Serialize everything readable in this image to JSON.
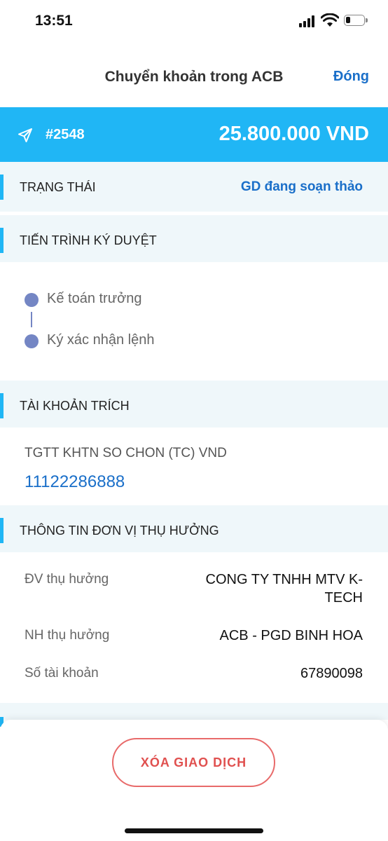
{
  "status_bar": {
    "time": "13:51"
  },
  "nav": {
    "title": "Chuyển khoản trong ACB",
    "close_label": "Đóng"
  },
  "banner": {
    "transaction_id": "#2548",
    "amount": "25.800.000 VND"
  },
  "status_section": {
    "label": "TRẠNG THÁI",
    "value": "GD đang soạn thảo"
  },
  "approval_section": {
    "label": "TIẾN TRÌNH KÝ DUYỆT",
    "steps": [
      "Kế toán trưởng",
      "Ký xác nhận lệnh"
    ]
  },
  "source_account_section": {
    "label": "TÀI KHOẢN TRÍCH",
    "account_name": "TGTT KHTN SO CHON (TC) VND",
    "account_number": "11122286888"
  },
  "beneficiary_section": {
    "label": "THÔNG TIN ĐƠN VỊ THỤ HƯỞNG",
    "rows": [
      {
        "label": "ĐV thụ hưởng",
        "value": "CONG TY TNHH MTV K-TECH"
      },
      {
        "label": "NH thụ hưởng",
        "value": "ACB - PGD BINH HOA"
      },
      {
        "label": "Số tài khoản",
        "value": "67890098"
      }
    ]
  },
  "actions": {
    "delete_label": "XÓA GIAO DỊCH"
  },
  "colors": {
    "accent": "#20b6f5",
    "link": "#1a6fc9",
    "danger": "#e0504f",
    "section_bg": "#eff7fa",
    "timeline_dot": "#7486c4"
  }
}
